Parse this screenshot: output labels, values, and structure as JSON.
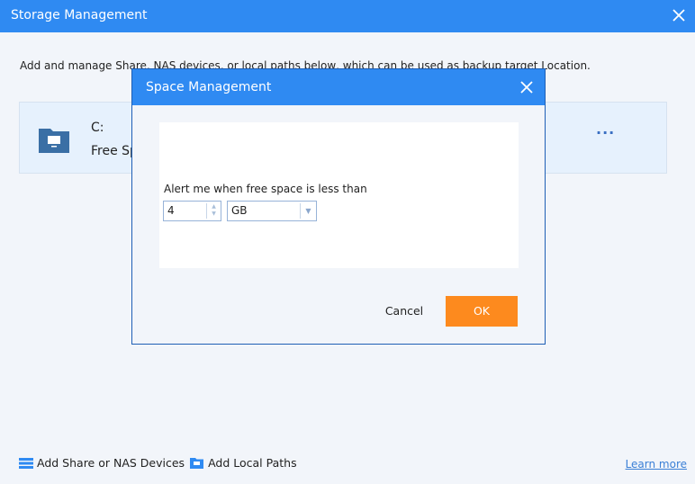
{
  "window": {
    "title": "Storage Management",
    "description": "Add and manage Share, NAS devices, or local paths below, which can be used as backup target Location."
  },
  "storage_item": {
    "drive": "C:",
    "free_label": "Free Space",
    "more_label": "···"
  },
  "footer": {
    "add_share": "Add Share or NAS Devices",
    "add_local": "Add Local Paths",
    "learn_more": "Learn more"
  },
  "dialog": {
    "title": "Space Management",
    "alert_label": "Alert me when free space is less than",
    "threshold_value": "4",
    "unit_selected": "GB",
    "cancel": "Cancel",
    "ok": "OK"
  },
  "colors": {
    "accent": "#2f8af2",
    "ok_button": "#fd8a1e",
    "folder": "#3a6fa5"
  }
}
